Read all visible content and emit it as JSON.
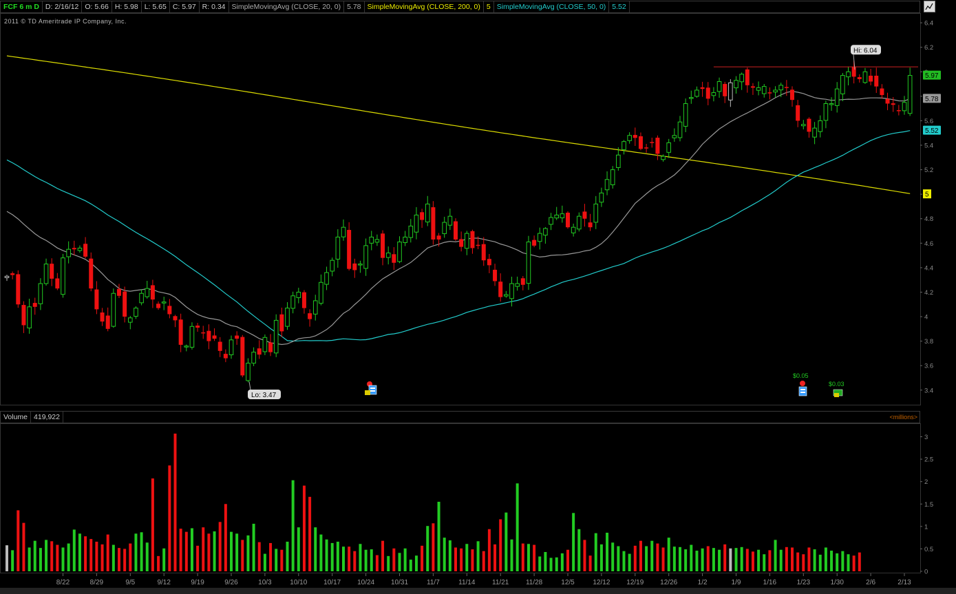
{
  "header": {
    "symbol": "FCF 6 m D",
    "date": "D: 2/16/12",
    "open": "O: 5.66",
    "high": "H: 5.98",
    "low": "L: 5.65",
    "close": "C: 5.97",
    "range": "R: 0.34",
    "sma20_label": "SimpleMovingAvg (CLOSE, 20, 0)",
    "sma20_value": "5.78",
    "sma200_label": "SimpleMovingAvg (CLOSE, 200, 0)",
    "sma200_value": "5",
    "sma50_label": "SimpleMovingAvg (CLOSE, 50, 0)",
    "sma50_value": "5.52"
  },
  "copyright": "2011 © TD Ameritrade IP Company, Inc.",
  "volume_header": {
    "label": "Volume",
    "value": "419,922",
    "units": "<millions>"
  },
  "annotations": {
    "hi": "Hi: 6.04",
    "lo": "Lo: 3.47",
    "dividend1": "$0.05",
    "dividend2": "$0.03"
  },
  "colors": {
    "up": "#22cc22",
    "down": "#ee1111",
    "sma20": "#999999",
    "sma50": "#22cccc",
    "sma200": "#dddd00",
    "resistance": "#cc2222"
  },
  "chart_data": {
    "type": "candlestick",
    "price_axis": {
      "ticks": [
        "3.4",
        "3.6",
        "3.8",
        "4",
        "4.2",
        "4.4",
        "4.6",
        "4.8",
        "5",
        "5.2",
        "5.4",
        "5.6",
        "5.8",
        "6",
        "6.2",
        "6.4"
      ],
      "range": [
        3.32,
        6.44
      ]
    },
    "volume_axis": {
      "ticks": [
        "0",
        "0.5",
        "1",
        "1.5",
        "2",
        "2.5",
        "3"
      ],
      "range": [
        0,
        3.1
      ],
      "units": "millions"
    },
    "x_labels": [
      "8/22",
      "8/29",
      "9/5",
      "9/12",
      "9/19",
      "9/26",
      "10/3",
      "10/10",
      "10/17",
      "10/24",
      "10/31",
      "11/7",
      "11/14",
      "11/21",
      "11/28",
      "12/5",
      "12/12",
      "12/19",
      "12/26",
      "1/2",
      "1/9",
      "1/16",
      "1/23",
      "1/30",
      "2/6",
      "2/13"
    ],
    "x_label_bar_index": [
      10,
      16,
      22,
      28,
      34,
      40,
      46,
      52,
      58,
      64,
      70,
      76,
      82,
      88,
      94,
      100,
      106,
      112,
      118,
      124,
      130,
      136,
      142,
      148,
      154,
      160
    ],
    "resistance": 6.04,
    "last_values": {
      "close": "5.97",
      "sma20": "5.78",
      "sma50": "5.52",
      "sma200": "5"
    },
    "closes": [
      4.33,
      4.34,
      4.1,
      3.93,
      4.08,
      4.08,
      4.27,
      4.43,
      4.31,
      4.23,
      4.48,
      4.55,
      4.55,
      4.56,
      4.49,
      4.23,
      4.06,
      3.96,
      3.9,
      4.19,
      4.17,
      4.0,
      3.99,
      4.07,
      4.19,
      4.23,
      4.14,
      4.07,
      4.12,
      4.02,
      3.97,
      3.77,
      3.76,
      3.92,
      3.91,
      3.87,
      3.8,
      3.82,
      3.72,
      3.66,
      3.81,
      3.82,
      3.52,
      3.62,
      3.71,
      3.69,
      3.83,
      3.71,
      3.97,
      3.88,
      4.07,
      4.17,
      4.2,
      4.07,
      3.98,
      4.13,
      4.28,
      4.36,
      4.46,
      4.65,
      4.73,
      4.39,
      4.38,
      4.43,
      4.58,
      4.65,
      4.63,
      4.48,
      4.52,
      4.44,
      4.61,
      4.65,
      4.74,
      4.83,
      4.79,
      4.92,
      4.63,
      4.63,
      4.77,
      4.82,
      4.63,
      4.57,
      4.68,
      4.56,
      4.58,
      4.46,
      4.42,
      4.29,
      4.16,
      4.18,
      4.27,
      4.27,
      4.26,
      4.61,
      4.58,
      4.68,
      4.72,
      4.81,
      4.83,
      4.84,
      4.73,
      4.73,
      4.82,
      4.8,
      4.73,
      4.92,
      5.01,
      5.12,
      5.2,
      5.32,
      5.43,
      5.48,
      5.46,
      5.37,
      5.38,
      5.42,
      5.33,
      5.31,
      5.42,
      5.48,
      5.59,
      5.74,
      5.79,
      5.85,
      5.86,
      5.78,
      5.83,
      5.92,
      5.8,
      5.91,
      5.93,
      5.98,
      5.89,
      5.87,
      5.87,
      5.88,
      5.83,
      5.85,
      5.89,
      5.87,
      5.77,
      5.6,
      5.57,
      5.51,
      5.54,
      5.6,
      5.74,
      5.74,
      5.86,
      5.97,
      6.0,
      5.96,
      5.94,
      6.0,
      5.92,
      5.88,
      5.81,
      5.74,
      5.73,
      5.68,
      5.75,
      5.97
    ],
    "volumes_millions": [
      0.58,
      0.47,
      1.36,
      1.08,
      0.53,
      0.68,
      0.52,
      0.7,
      0.67,
      0.59,
      0.53,
      0.62,
      0.93,
      0.84,
      0.78,
      0.72,
      0.66,
      0.6,
      0.82,
      0.59,
      0.52,
      0.5,
      0.62,
      0.84,
      0.87,
      0.64,
      2.07,
      0.34,
      0.51,
      2.36,
      3.07,
      0.95,
      0.88,
      0.96,
      0.57,
      0.98,
      0.84,
      0.89,
      1.1,
      1.5,
      0.88,
      0.84,
      0.7,
      0.8,
      1.06,
      0.65,
      0.39,
      0.63,
      0.5,
      0.48,
      0.66,
      2.03,
      0.98,
      1.91,
      1.66,
      0.98,
      0.82,
      0.71,
      0.63,
      0.66,
      0.55,
      0.55,
      0.45,
      0.61,
      0.48,
      0.49,
      0.36,
      0.68,
      0.34,
      0.51,
      0.41,
      0.51,
      0.26,
      0.35,
      0.57,
      1.01,
      1.07,
      1.55,
      0.75,
      0.69,
      0.53,
      0.51,
      0.61,
      0.49,
      0.67,
      0.45,
      0.94,
      0.6,
      1.16,
      1.31,
      0.71,
      1.96,
      0.62,
      0.61,
      0.59,
      0.33,
      0.43,
      0.3,
      0.31,
      0.4,
      0.48,
      1.3,
      0.94,
      0.7,
      0.35,
      0.85,
      0.6,
      0.86,
      0.64,
      0.56,
      0.45,
      0.39,
      0.57,
      0.68,
      0.56,
      0.68,
      0.62,
      0.53,
      0.75,
      0.55,
      0.54,
      0.49,
      0.59,
      0.46,
      0.51,
      0.56,
      0.52,
      0.48,
      0.6,
      0.51,
      0.52,
      0.54,
      0.5,
      0.44,
      0.48,
      0.38,
      0.47,
      0.7,
      0.48,
      0.54,
      0.53,
      0.42,
      0.38,
      0.53,
      0.49,
      0.37,
      0.53,
      0.46,
      0.4,
      0.45,
      0.38,
      0.35,
      0.42
    ],
    "hi_value": 6.04,
    "lo_value": 3.47
  }
}
